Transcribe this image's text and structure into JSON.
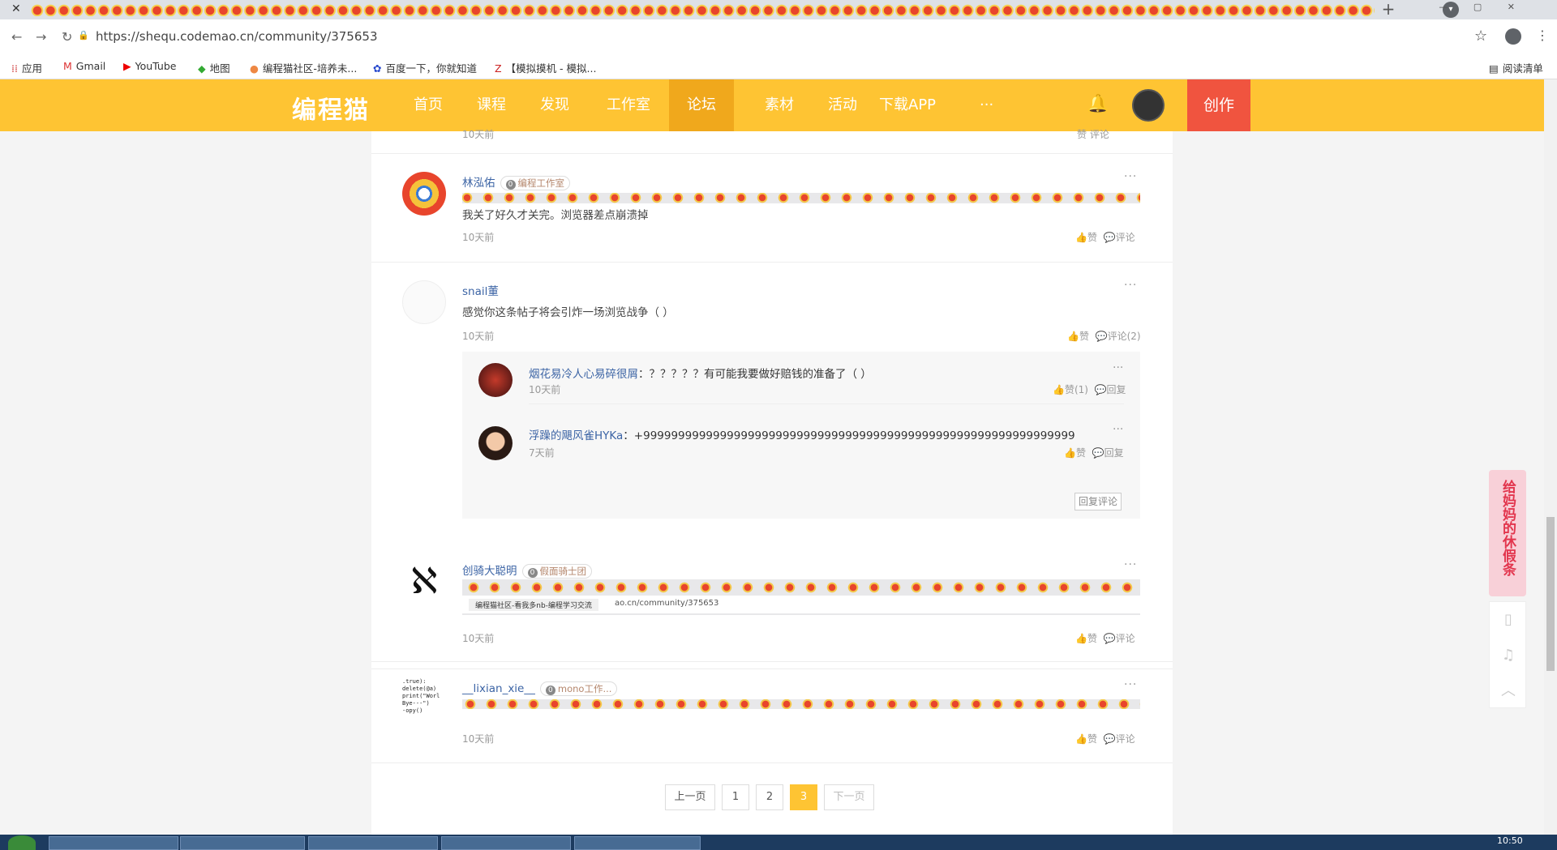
{
  "browser": {
    "url": "https://shequ.codemao.cn/community/375653",
    "bookmarks": [
      "应用",
      "Gmail",
      "YouTube",
      "地图",
      "编程猫社区-培养未...",
      "百度一下，你就知道",
      "【模拟摸机 - 模拟..."
    ],
    "reading_list": "阅读清单"
  },
  "nav": {
    "logo": "编程猫",
    "items": [
      "首页",
      "课程",
      "发现",
      "工作室",
      "论坛",
      "素材",
      "活动",
      "下载APP",
      "···"
    ],
    "active": "论坛",
    "create": "创作"
  },
  "top_comment": {
    "time": "10天前",
    "actions": "赞  评论"
  },
  "comments": [
    {
      "name": "林泓佑",
      "badge": "编程工作室",
      "text": "我关了好久才关完。浏览器差点崩溃掉",
      "time": "10天前",
      "like": "赞",
      "reply": "评论"
    },
    {
      "name": "snail董",
      "text": "感觉你这条帖子将会引炸一场浏览战争（ ）",
      "time": "10天前",
      "like": "赞",
      "reply": "评论(2)",
      "replies": [
        {
          "name": "烟花易冷人心易碎很屑",
          "text": "：？？？？？有可能我要做好赔钱的准备了（ ）",
          "time": "10天前",
          "like": "赞(1)",
          "reply": "回复"
        },
        {
          "name": "浮躁的飓风雀HYKa",
          "text": "：+99999999999999999999999999999999999999999999999999999999999999",
          "time": "7天前",
          "like": "赞",
          "reply": "回复"
        }
      ],
      "reply_button": "回复评论"
    },
    {
      "name": "创骑大聪明",
      "badge": "假面骑士团",
      "strip_url": "ao.cn/community/375653",
      "strip_title": "编程猫社区-看我多nb-编程学习交流",
      "time": "10天前",
      "like": "赞",
      "reply": "评论"
    },
    {
      "name": "__lixian_xie__",
      "badge": "mono工作...",
      "avatar_text": ".true):\ndelete(@a)\nprint(\"Worl\nBye---\")\n-opy()",
      "time": "10天前",
      "like": "赞",
      "reply": "评论"
    }
  ],
  "pager": {
    "prev": "上一页",
    "pages": [
      "1",
      "2",
      "3"
    ],
    "current": "3",
    "next": "下一页"
  },
  "side_ad": "给妈妈的休假条",
  "taskbar": {
    "time": "10:50"
  },
  "colors": {
    "brand": "#fec433",
    "active": "#f0a81c",
    "create": "#f0543f",
    "link": "#3c64a5"
  }
}
